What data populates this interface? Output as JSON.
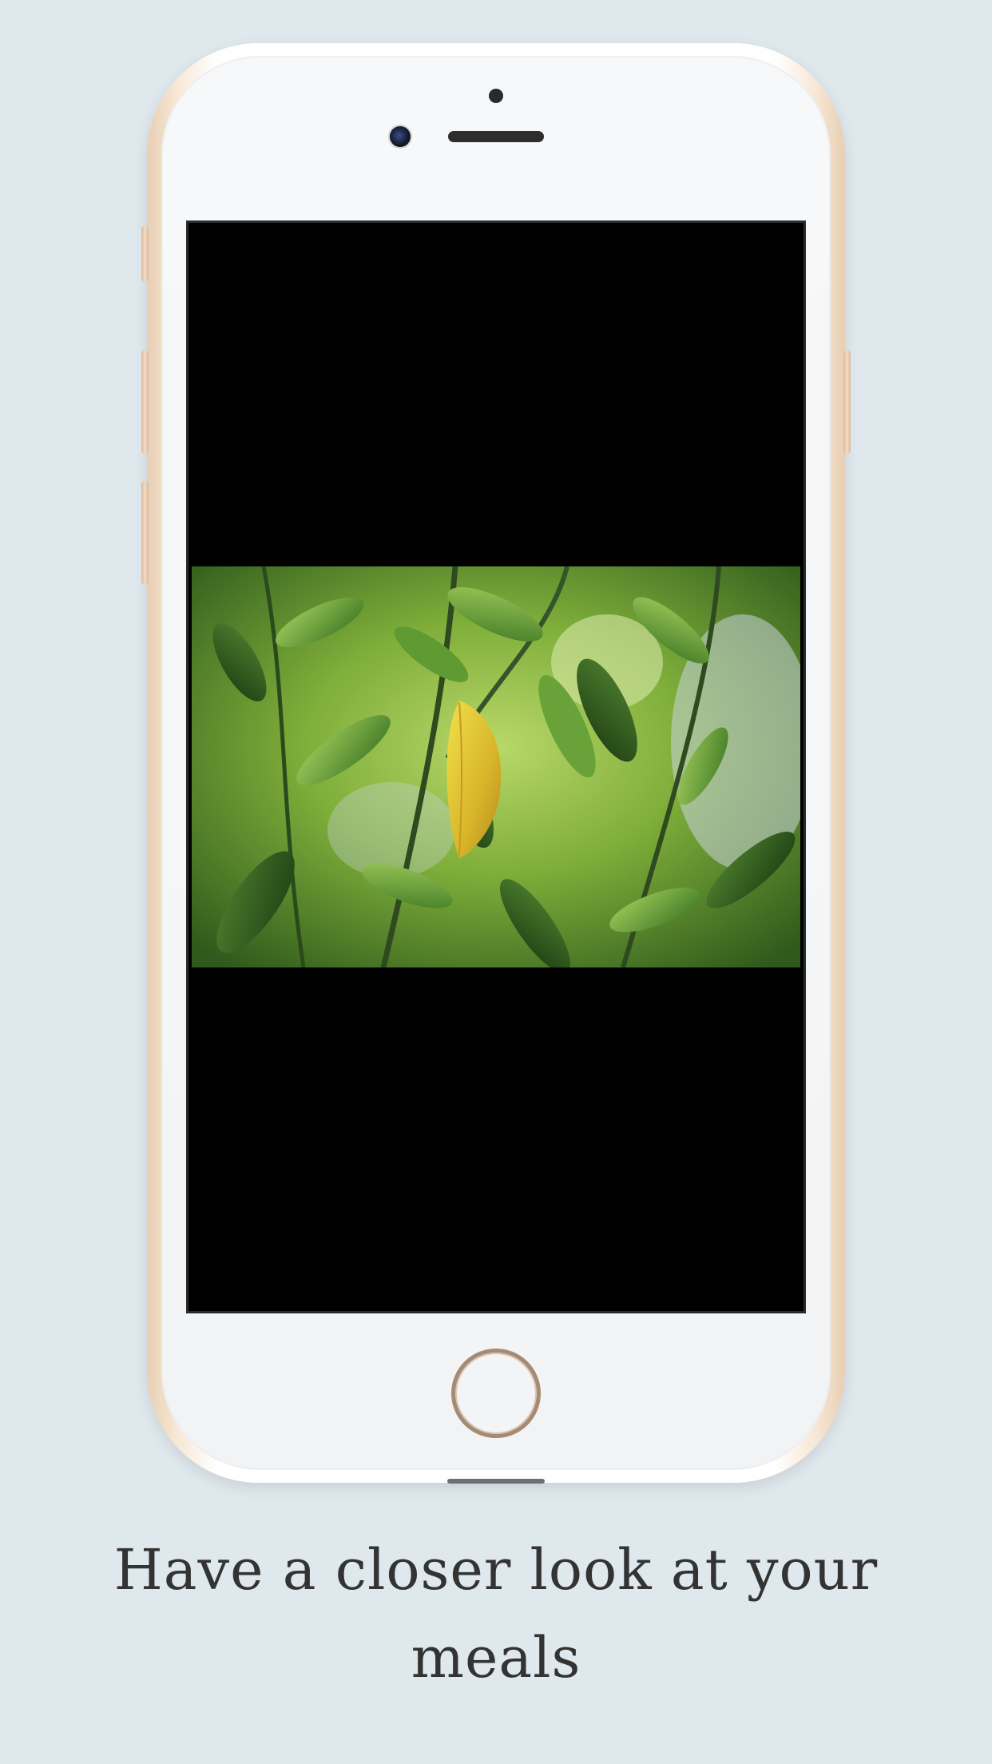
{
  "caption": {
    "line1": "Have a closer look at your",
    "line2": "meals"
  },
  "device": {
    "frame_color": "#f3e2cf",
    "screen_color": "#000000",
    "background_color": "#dfe8ed"
  },
  "icons": {
    "front_camera": "front-camera-icon",
    "speaker": "speaker-grille-icon",
    "home_button": "home-button-icon"
  },
  "photo": {
    "subject": "green leaves with one yellow leaf"
  }
}
